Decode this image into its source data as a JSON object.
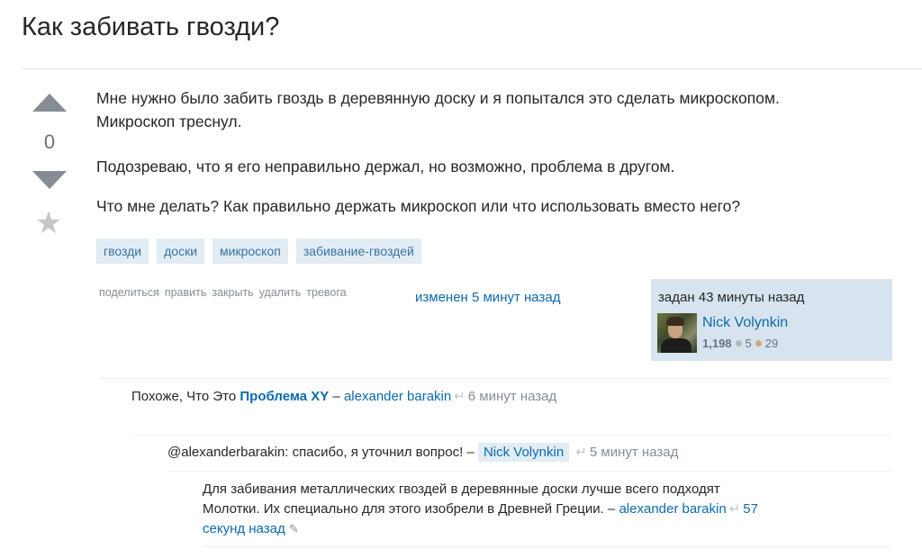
{
  "question": {
    "title": "Как забивать гвозди?",
    "score": "0",
    "body": {
      "p1": "Мне нужно было забить гвоздь в деревянную доску и я попытался это сделать микроскопом. Микроскоп треснул.",
      "p2": "Подозреваю, что я его неправильно держал, но возможно, проблема в другом.",
      "p3": "Что мне делать? Как правильно держать микроскоп или что использовать вместо него?"
    },
    "tags": [
      "гвозди",
      "доски",
      "микроскоп",
      "забивание-гвоздей"
    ],
    "menu": [
      "поделиться",
      "править",
      "закрыть",
      "удалить",
      "тревога"
    ],
    "edited": "изменен 5 минут назад",
    "asked": "задан 43 минуты назад",
    "user": {
      "name": "Nick Volynkin",
      "reputation": "1,198",
      "silver": "5",
      "bronze": "29"
    }
  },
  "comments": [
    {
      "text_before": "Похоже, Что Это ",
      "link": "Проблема XY",
      "dash": " – ",
      "user": "alexander barakin",
      "time": "6 минут назад"
    },
    {
      "text": "@alexanderbarakin: спасибо, я уточнил вопрос! – ",
      "user": "Nick Volynkin",
      "time": "5 минут назад"
    },
    {
      "line1": "Для забивания металлических гвоздей в деревянные доски лучше всего подходят",
      "line2": "Молотки. Их специально для этого изобрели в Древней Греции. – ",
      "user": "alexander barakin",
      "time_a": "57",
      "time_b": "секунд назад"
    }
  ],
  "colors": {
    "link": "#0c6aac",
    "tag_bg": "#e1ecf4",
    "tag_text": "#39739d",
    "card_bg": "#d7e4ef"
  },
  "icons": {
    "vote_up": "triangle-up-icon",
    "vote_down": "triangle-down-icon",
    "favorite": "star-icon",
    "reply": "reply-arrow-icon",
    "edit": "pencil-icon"
  }
}
